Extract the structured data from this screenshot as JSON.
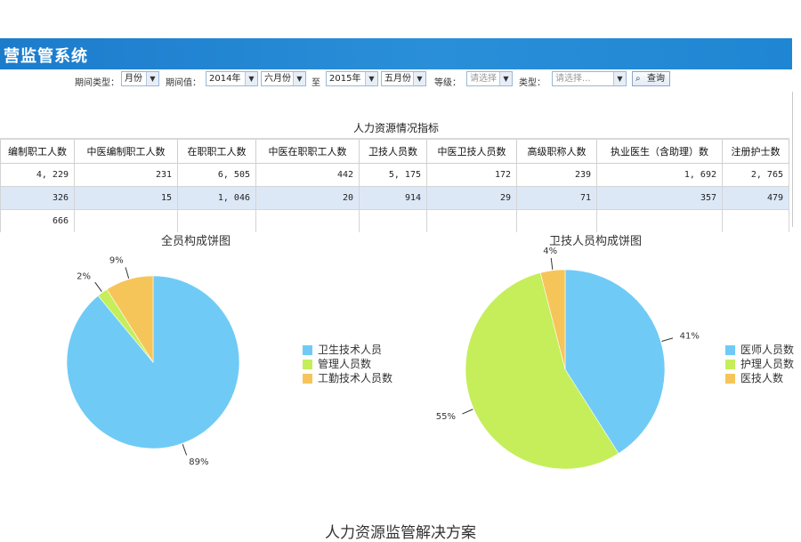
{
  "app": {
    "title": "营监管系统"
  },
  "filters": {
    "period_type_label": "期间类型：",
    "period_type_value": "月份",
    "period_value_label": "期间值：",
    "from_year": "2014年",
    "from_month": "六月份",
    "to_label": "至",
    "to_year": "2015年",
    "to_month": "五月份",
    "level_label": "等级：",
    "level_placeholder": "请选择",
    "type_label": "类型：",
    "type_placeholder": "请选择...",
    "query_label": "查询"
  },
  "table": {
    "title": "人力资源情况指标",
    "headers": [
      "编制职工人数",
      "中医编制职工人数",
      "在职职工人数",
      "中医在职职工人数",
      "卫技人员数",
      "中医卫技人员数",
      "高级职称人数",
      "执业医生（含助理）数",
      "注册护士数"
    ],
    "rows": [
      [
        "4, 229",
        "231",
        "6, 505",
        "442",
        "5, 175",
        "172",
        "239",
        "1, 692",
        "2, 765"
      ],
      [
        "326",
        "15",
        "1, 046",
        "20",
        "914",
        "29",
        "71",
        "357",
        "479"
      ],
      [
        "666",
        "",
        "",
        "",
        "",
        "",
        "",
        "",
        ""
      ]
    ]
  },
  "chart_data": [
    {
      "type": "pie",
      "title": "全员构成饼图",
      "categories": [
        "卫生技术人员",
        "管理人员数",
        "工勤技术人员数"
      ],
      "values": [
        89,
        2,
        9
      ],
      "labels": [
        "89%",
        "2%",
        "9%"
      ],
      "colors": [
        "#6fcbf5",
        "#c5ee5a",
        "#f6c55a"
      ],
      "legend": "right"
    },
    {
      "type": "pie",
      "title": "卫技人员构成饼图",
      "categories": [
        "医师人员数",
        "护理人员数",
        "医技人数"
      ],
      "values": [
        41,
        55,
        4
      ],
      "labels": [
        "41%",
        "55%",
        "4%"
      ],
      "colors": [
        "#6fcbf5",
        "#c5ee5a",
        "#f6c55a"
      ],
      "legend": "right"
    }
  ],
  "caption": "人力资源监管解决方案"
}
